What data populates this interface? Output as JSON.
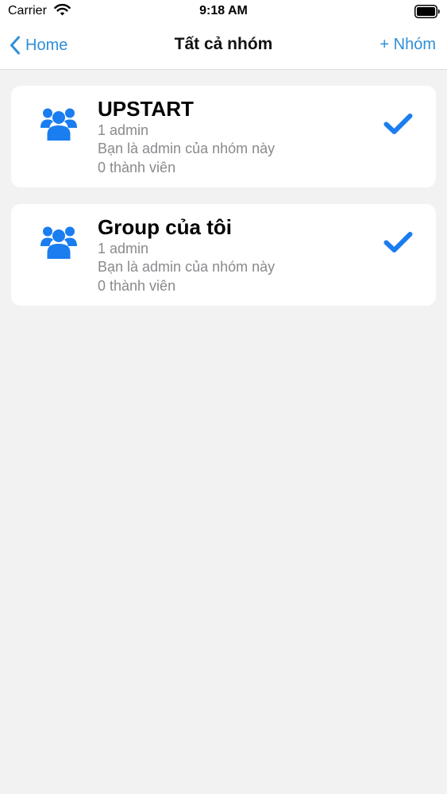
{
  "status_bar": {
    "carrier": "Carrier",
    "time": "9:18 AM"
  },
  "nav": {
    "back_label": "Home",
    "title": "Tất cả nhóm",
    "add_label": "+ Nhóm"
  },
  "groups": [
    {
      "name": "UPSTART",
      "admins": "1 admin",
      "role": "Bạn là admin của nhóm này",
      "members": "0 thành viên",
      "icon": "users-icon",
      "selected": true
    },
    {
      "name": "Group của tôi",
      "admins": "1 admin",
      "role": "Bạn là admin của nhóm này",
      "members": "0 thành viên",
      "icon": "users-icon",
      "selected": true
    }
  ],
  "colors": {
    "accent": "#2f8fd8",
    "icon_blue": "#1a7df0",
    "background": "#f2f2f2",
    "secondary_text": "#8a8a8e"
  }
}
